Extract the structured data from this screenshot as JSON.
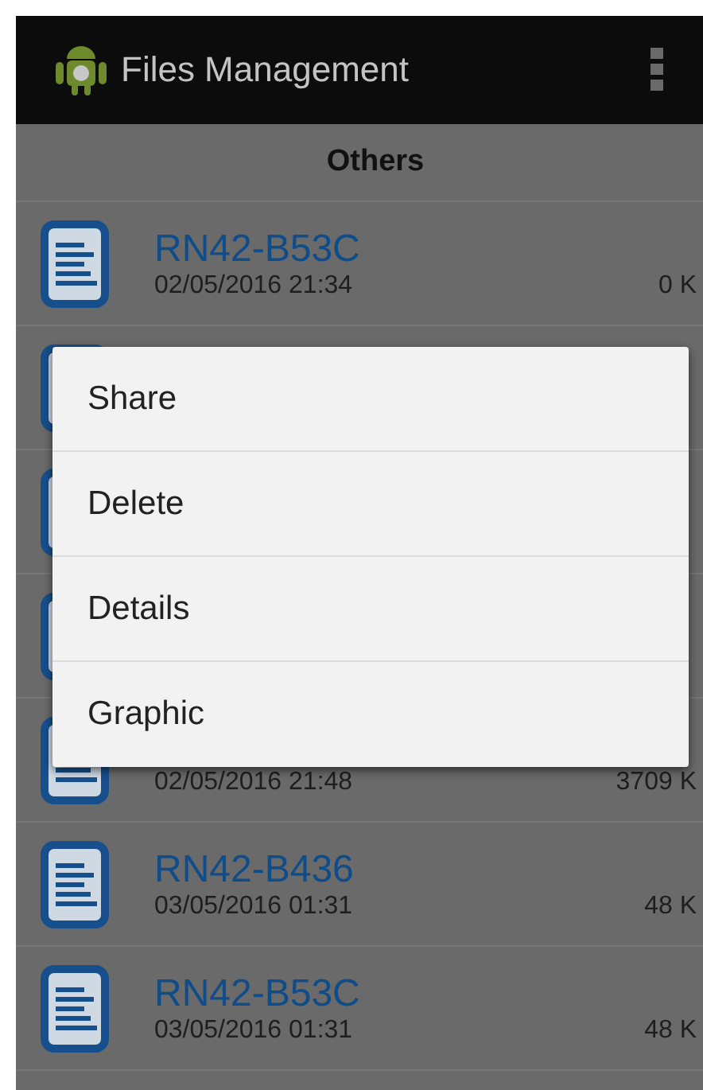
{
  "app_bar": {
    "title": "Files Management"
  },
  "section": {
    "title": "Others"
  },
  "files": [
    {
      "kind": "file",
      "name": "RN42-B53C",
      "date": "02/05/2016 21:34",
      "size": "0 K"
    },
    {
      "kind": "covered"
    },
    {
      "kind": "covered"
    },
    {
      "kind": "covered"
    },
    {
      "kind": "file",
      "date": "02/05/2016 21:48",
      "size": "3709 K"
    },
    {
      "kind": "file",
      "name": "RN42-B436",
      "date": "03/05/2016 01:31",
      "size": "48 K"
    },
    {
      "kind": "file",
      "name": "RN42-B53C",
      "date": "03/05/2016 01:31",
      "size": "48 K"
    }
  ],
  "context_menu": {
    "items": [
      "Share",
      "Delete",
      "Details",
      "Graphic"
    ]
  }
}
